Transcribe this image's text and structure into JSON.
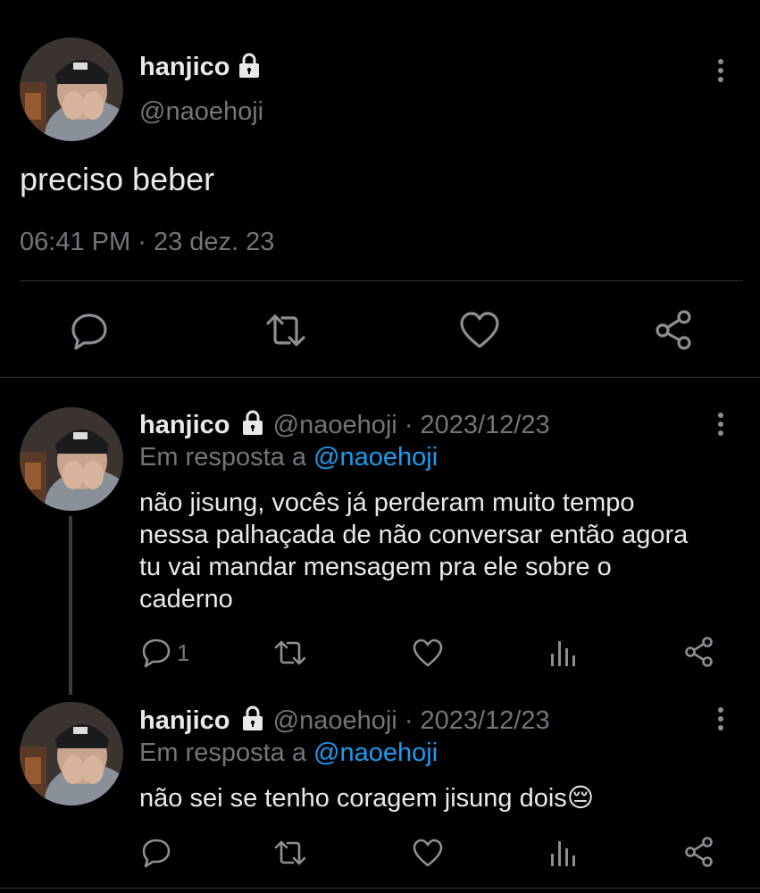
{
  "main_tweet": {
    "name": "hanjico",
    "handle": "@naoehoji",
    "text": "preciso beber",
    "time": "06:41 PM",
    "separator": "·",
    "date": "23 dez. 23"
  },
  "replies": [
    {
      "name": "hanjico",
      "handle": "@naoehoji",
      "separator": "·",
      "date": "2023/12/23",
      "reply_to_label": "Em resposta a",
      "reply_to_handle": "@naoehoji",
      "lines": [
        "não jisung, vocês já perderam muito tempo",
        "nessa palhaçada de não conversar então agora",
        "tu vai mandar mensagem pra ele sobre o",
        "caderno"
      ],
      "reply_count": "1"
    },
    {
      "name": "hanjico",
      "handle": "@naoehoji",
      "separator": "·",
      "date": "2023/12/23",
      "reply_to_label": "Em resposta a",
      "reply_to_handle": "@naoehoji",
      "text": "não sei se tenho coragem jisung dois",
      "emoji": "😔",
      "reply_count": ""
    }
  ],
  "colors": {
    "background": "#000000",
    "text": "#e7e9ea",
    "secondary": "#71767b",
    "link": "#1d9bf0",
    "divider": "#2f3336"
  },
  "icons": [
    "lock-icon",
    "more-icon",
    "reply-icon",
    "retweet-icon",
    "like-icon",
    "share-icon",
    "views-icon"
  ]
}
